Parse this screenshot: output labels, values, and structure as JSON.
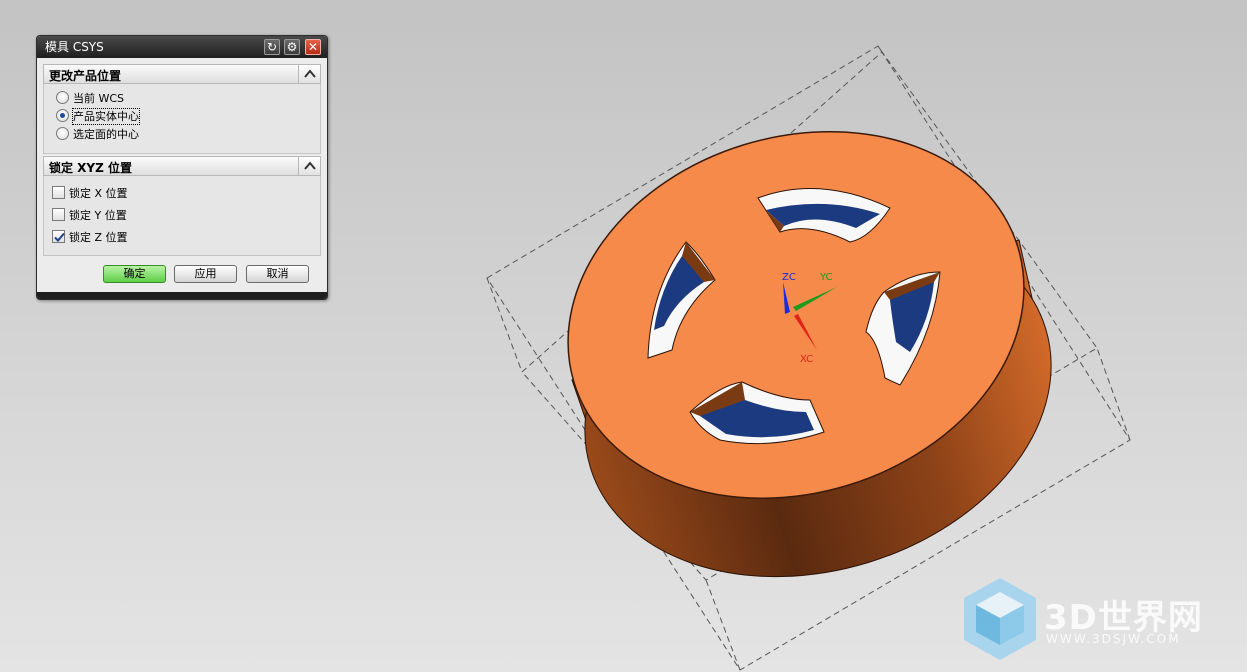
{
  "dialog": {
    "title": "模具 CSYS",
    "section1": {
      "title": "更改产品位置",
      "options": [
        {
          "label": "当前 WCS",
          "selected": false
        },
        {
          "label": "产品实体中心",
          "selected": true
        },
        {
          "label": "选定面的中心",
          "selected": false
        }
      ]
    },
    "section2": {
      "title": "锁定 XYZ 位置",
      "checks": [
        {
          "label": "锁定 X 位置",
          "checked": false
        },
        {
          "label": "锁定 Y 位置",
          "checked": false
        },
        {
          "label": "锁定 Z 位置",
          "checked": true
        }
      ]
    },
    "buttons": {
      "ok": "确定",
      "apply": "应用",
      "cancel": "取消"
    }
  },
  "viewport": {
    "axes": {
      "z": "ZC",
      "y": "YC",
      "x": "XC"
    },
    "part_color": "#f58a4a",
    "pocket_color": "#1c3a80"
  },
  "watermark": {
    "text": "3D世界网",
    "url": "WWW.3DSJW.COM"
  }
}
